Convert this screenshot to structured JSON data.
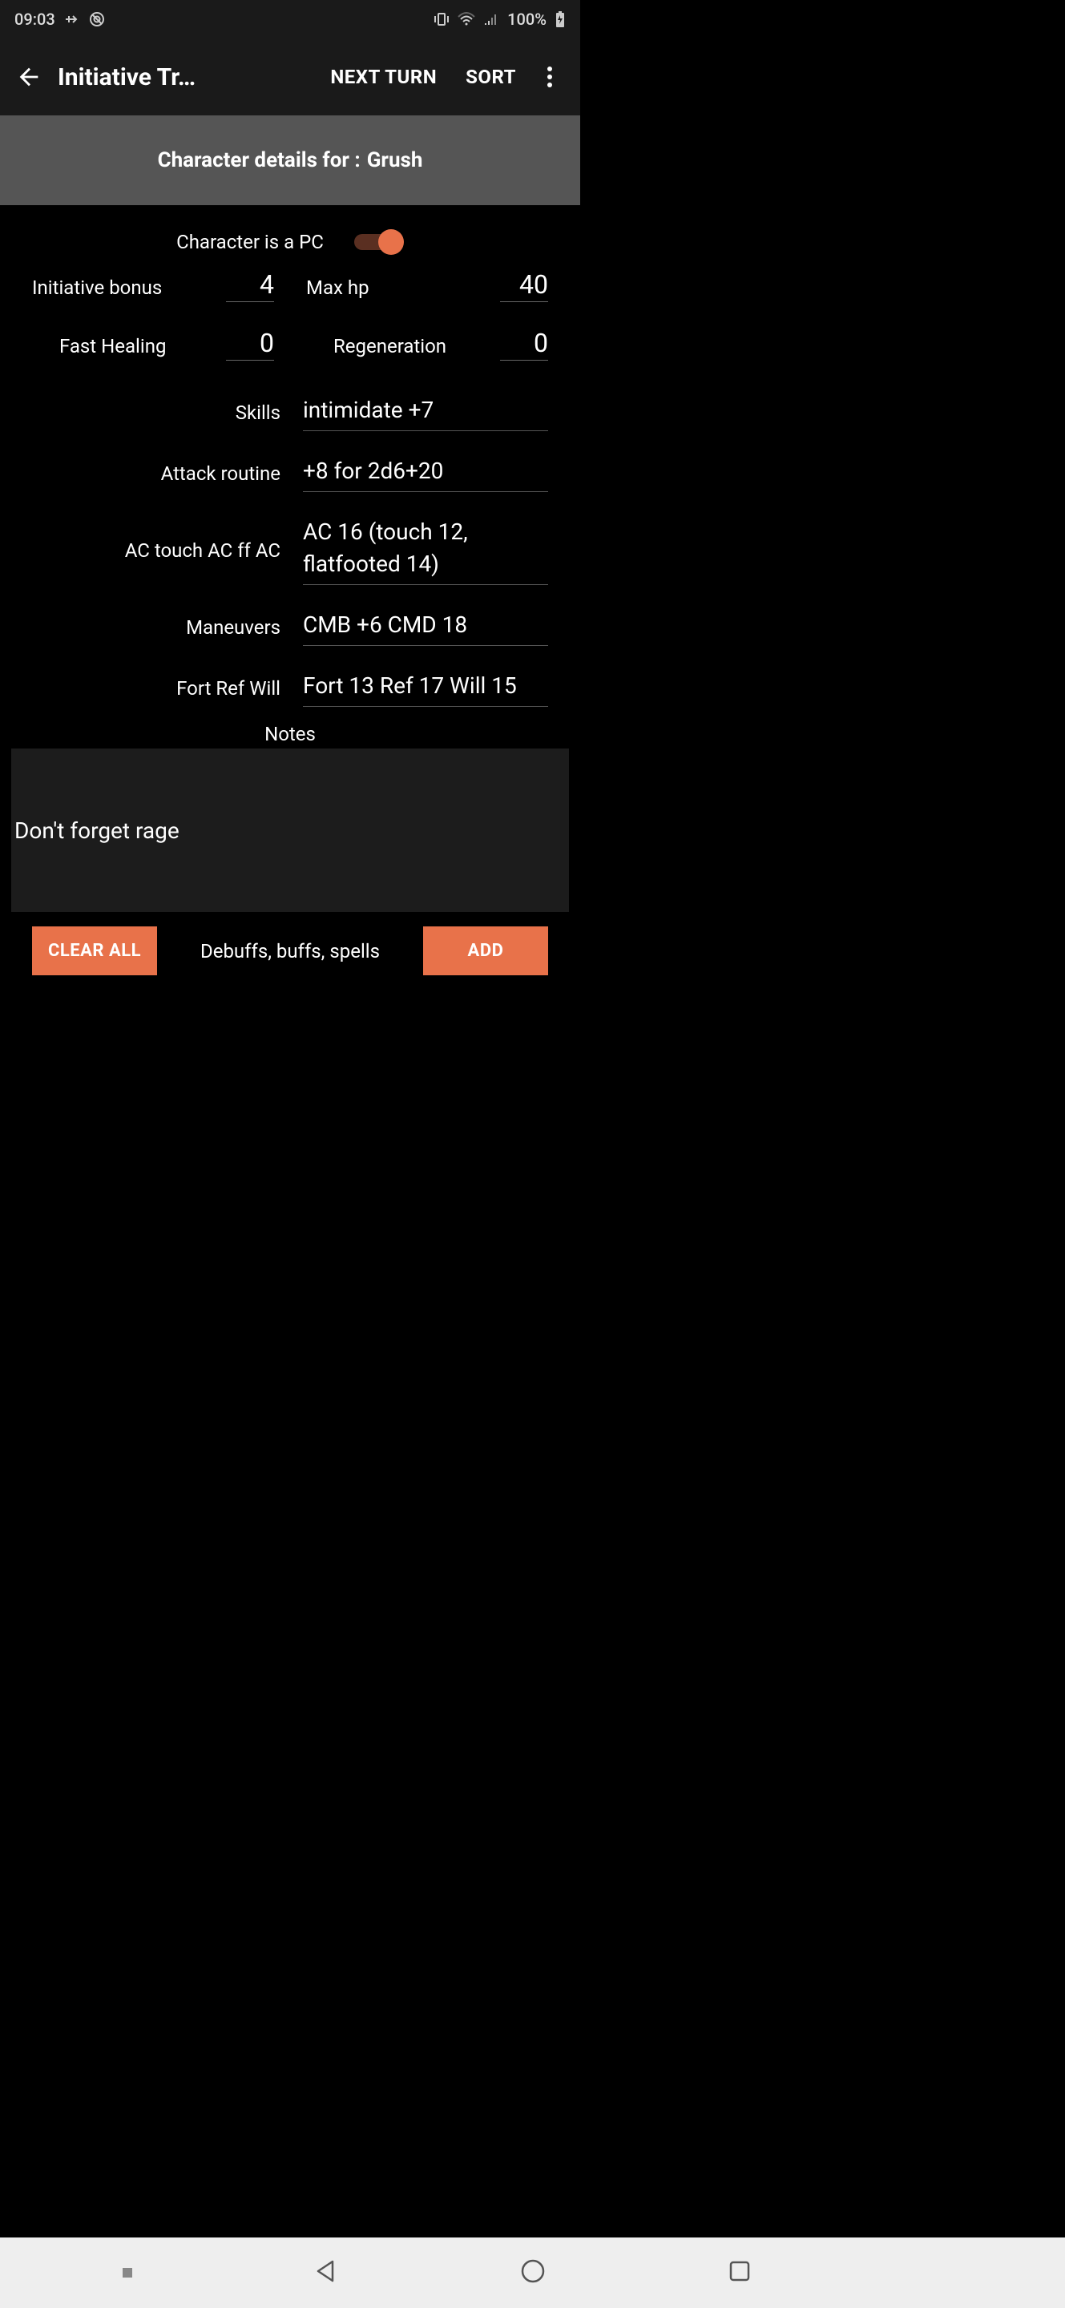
{
  "status": {
    "time": "09:03",
    "battery": "100%"
  },
  "appbar": {
    "title": "Initiative Tr…",
    "next_turn": "NEXT TURN",
    "sort": "SORT"
  },
  "charHeader": {
    "prefix": "Character details for :",
    "name": "Grush"
  },
  "pcToggle": {
    "label": "Character is a PC",
    "on": true
  },
  "stats": {
    "initBonus": {
      "label": "Initiative bonus",
      "value": "4"
    },
    "maxHp": {
      "label": "Max hp",
      "value": "40"
    },
    "fastHeal": {
      "label": "Fast Healing",
      "value": "0"
    },
    "regen": {
      "label": "Regeneration",
      "value": "0"
    },
    "skills": {
      "label": "Skills",
      "value": "intimidate +7"
    },
    "attack": {
      "label": "Attack routine",
      "value": "+8 for 2d6+20"
    },
    "ac": {
      "label": "AC touch AC ff AC",
      "value": "AC 16 (touch 12, flatfooted 14)"
    },
    "maneuvers": {
      "label": "Maneuvers",
      "value": "CMB +6 CMD 18"
    },
    "saves": {
      "label": "Fort Ref Will",
      "value": "Fort 13 Ref 17 Will 15"
    }
  },
  "notes": {
    "label": "Notes",
    "value": "Don't forget rage"
  },
  "buffs": {
    "clear": "CLEAR ALL",
    "label": "Debuffs, buffs, spells",
    "add": "ADD"
  }
}
